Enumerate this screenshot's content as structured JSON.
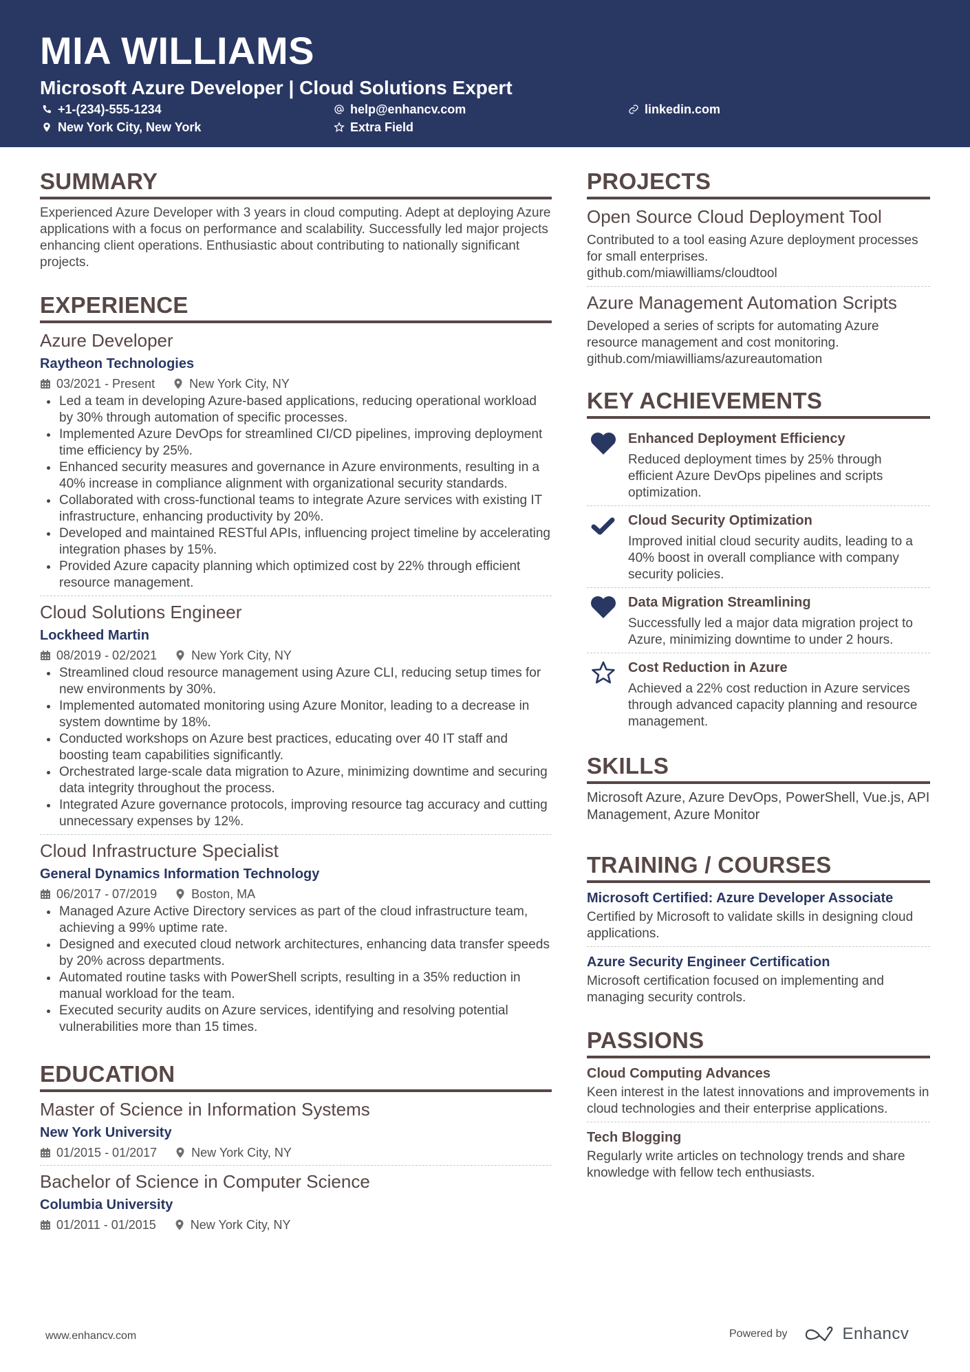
{
  "header": {
    "name": "MIA WILLIAMS",
    "title": "Microsoft Azure Developer | Cloud Solutions Expert",
    "contacts": [
      {
        "icon": "phone-icon",
        "text": "+1-(234)-555-1234"
      },
      {
        "icon": "at-icon",
        "text": "help@enhancv.com"
      },
      {
        "icon": "link-icon",
        "text": "linkedin.com"
      },
      {
        "icon": "location-icon",
        "text": "New York City, New York"
      },
      {
        "icon": "star-icon",
        "text": "Extra Field"
      }
    ]
  },
  "summary": {
    "title": "SUMMARY",
    "text": "Experienced Azure Developer with 3 years in cloud computing. Adept at deploying Azure applications with a focus on performance and scalability. Successfully led major projects enhancing client operations. Enthusiastic about contributing to nationally significant projects."
  },
  "experience": {
    "title": "EXPERIENCE",
    "items": [
      {
        "role": "Azure Developer",
        "company": "Raytheon Technologies",
        "dates": "03/2021 - Present",
        "location": "New York City, NY",
        "bullets": [
          "Led a team in developing Azure-based applications, reducing operational workload by 30% through automation of specific processes.",
          "Implemented Azure DevOps for streamlined CI/CD pipelines, improving deployment time efficiency by 25%.",
          "Enhanced security measures and governance in Azure environments, resulting in a 40% increase in compliance alignment with organizational security standards.",
          "Collaborated with cross-functional teams to integrate Azure services with existing IT infrastructure, enhancing productivity by 20%.",
          "Developed and maintained RESTful APIs, influencing project timeline by accelerating integration phases by 15%.",
          "Provided Azure capacity planning which optimized cost by 22% through efficient resource management."
        ]
      },
      {
        "role": "Cloud Solutions Engineer",
        "company": "Lockheed Martin",
        "dates": "08/2019 - 02/2021",
        "location": "New York City, NY",
        "bullets": [
          "Streamlined cloud resource management using Azure CLI, reducing setup times for new environments by 30%.",
          "Implemented automated monitoring using Azure Monitor, leading to a decrease in system downtime by 18%.",
          "Conducted workshops on Azure best practices, educating over 40 IT staff and boosting team capabilities significantly.",
          "Orchestrated large-scale data migration to Azure, minimizing downtime and securing data integrity throughout the process.",
          "Integrated Azure governance protocols, improving resource tag accuracy and cutting unnecessary expenses by 12%."
        ]
      },
      {
        "role": "Cloud Infrastructure Specialist",
        "company": "General Dynamics Information Technology",
        "dates": "06/2017 - 07/2019",
        "location": "Boston, MA",
        "bullets": [
          "Managed Azure Active Directory services as part of the cloud infrastructure team, achieving a 99% uptime rate.",
          "Designed and executed cloud network architectures, enhancing data transfer speeds by 20% across departments.",
          "Automated routine tasks with PowerShell scripts, resulting in a 35% reduction in manual workload for the team.",
          "Executed security audits on Azure services, identifying and resolving potential vulnerabilities more than 15 times."
        ]
      }
    ]
  },
  "education": {
    "title": "EDUCATION",
    "items": [
      {
        "degree": "Master of Science in Information Systems",
        "school": "New York University",
        "dates": "01/2015 - 01/2017",
        "location": "New York City, NY"
      },
      {
        "degree": "Bachelor of Science in Computer Science",
        "school": "Columbia University",
        "dates": "01/2011 - 01/2015",
        "location": "New York City, NY"
      }
    ]
  },
  "projects": {
    "title": "PROJECTS",
    "items": [
      {
        "title": "Open Source Cloud Deployment Tool",
        "description": "Contributed to a tool easing Azure deployment processes for small enterprises.",
        "link": "github.com/miawilliams/cloudtool"
      },
      {
        "title": "Azure Management Automation Scripts",
        "description": "Developed a series of scripts for automating Azure resource management and cost monitoring.",
        "link": "github.com/miawilliams/azureautomation"
      }
    ]
  },
  "achievements": {
    "title": "KEY ACHIEVEMENTS",
    "items": [
      {
        "icon": "heart-icon",
        "title": "Enhanced Deployment Efficiency",
        "description": "Reduced deployment times by 25% through efficient Azure DevOps pipelines and scripts optimization."
      },
      {
        "icon": "checkmark-icon",
        "title": "Cloud Security Optimization",
        "description": "Improved initial cloud security audits, leading to a 40% boost in overall compliance with company security policies."
      },
      {
        "icon": "heart-icon",
        "title": "Data Migration Streamlining",
        "description": "Successfully led a major data migration project to Azure, minimizing downtime to under 2 hours."
      },
      {
        "icon": "star-icon",
        "title": "Cost Reduction in Azure",
        "description": "Achieved a 22% cost reduction in Azure services through advanced capacity planning and resource management."
      }
    ]
  },
  "skills": {
    "title": "SKILLS",
    "text": "Microsoft Azure, Azure DevOps, PowerShell, Vue.js, API Management, Azure Monitor"
  },
  "training": {
    "title": "TRAINING / COURSES",
    "items": [
      {
        "title": "Microsoft Certified: Azure Developer Associate",
        "description": "Certified by Microsoft to validate skills in designing cloud applications."
      },
      {
        "title": "Azure Security Engineer Certification",
        "description": "Microsoft certification focused on implementing and managing security controls."
      }
    ]
  },
  "passions": {
    "title": "PASSIONS",
    "items": [
      {
        "title": "Cloud Computing Advances",
        "description": "Keen interest in the latest innovations and improvements in cloud technologies and their enterprise applications."
      },
      {
        "title": "Tech Blogging",
        "description": "Regularly write articles on technology trends and share knowledge with fellow tech enthusiasts."
      }
    ]
  },
  "footer": {
    "website": "www.enhancv.com",
    "powered_by": "Powered by",
    "brand": "Enhancv"
  },
  "colors": {
    "header_bg": "#293763",
    "accent": "#293763",
    "heading": "#574746",
    "text": "#454545"
  }
}
